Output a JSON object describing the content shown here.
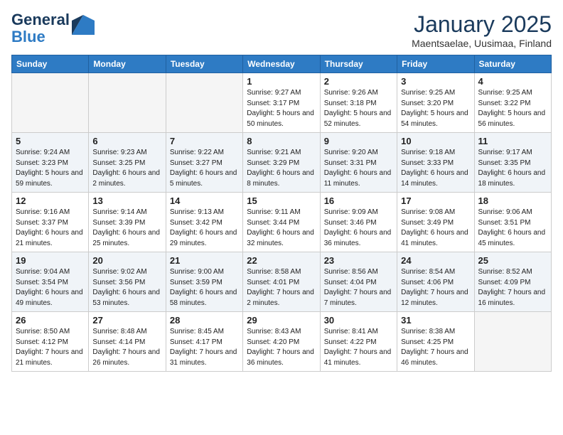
{
  "header": {
    "logo_general": "General",
    "logo_blue": "Blue",
    "month_year": "January 2025",
    "location": "Maentsaelae, Uusimaa, Finland"
  },
  "days_of_week": [
    "Sunday",
    "Monday",
    "Tuesday",
    "Wednesday",
    "Thursday",
    "Friday",
    "Saturday"
  ],
  "weeks": [
    [
      {
        "day": "",
        "sunrise": "",
        "sunset": "",
        "daylight": "",
        "empty": true
      },
      {
        "day": "",
        "sunrise": "",
        "sunset": "",
        "daylight": "",
        "empty": true
      },
      {
        "day": "",
        "sunrise": "",
        "sunset": "",
        "daylight": "",
        "empty": true
      },
      {
        "day": "1",
        "sunrise": "Sunrise: 9:27 AM",
        "sunset": "Sunset: 3:17 PM",
        "daylight": "Daylight: 5 hours and 50 minutes."
      },
      {
        "day": "2",
        "sunrise": "Sunrise: 9:26 AM",
        "sunset": "Sunset: 3:18 PM",
        "daylight": "Daylight: 5 hours and 52 minutes."
      },
      {
        "day": "3",
        "sunrise": "Sunrise: 9:25 AM",
        "sunset": "Sunset: 3:20 PM",
        "daylight": "Daylight: 5 hours and 54 minutes."
      },
      {
        "day": "4",
        "sunrise": "Sunrise: 9:25 AM",
        "sunset": "Sunset: 3:22 PM",
        "daylight": "Daylight: 5 hours and 56 minutes."
      }
    ],
    [
      {
        "day": "5",
        "sunrise": "Sunrise: 9:24 AM",
        "sunset": "Sunset: 3:23 PM",
        "daylight": "Daylight: 5 hours and 59 minutes."
      },
      {
        "day": "6",
        "sunrise": "Sunrise: 9:23 AM",
        "sunset": "Sunset: 3:25 PM",
        "daylight": "Daylight: 6 hours and 2 minutes."
      },
      {
        "day": "7",
        "sunrise": "Sunrise: 9:22 AM",
        "sunset": "Sunset: 3:27 PM",
        "daylight": "Daylight: 6 hours and 5 minutes."
      },
      {
        "day": "8",
        "sunrise": "Sunrise: 9:21 AM",
        "sunset": "Sunset: 3:29 PM",
        "daylight": "Daylight: 6 hours and 8 minutes."
      },
      {
        "day": "9",
        "sunrise": "Sunrise: 9:20 AM",
        "sunset": "Sunset: 3:31 PM",
        "daylight": "Daylight: 6 hours and 11 minutes."
      },
      {
        "day": "10",
        "sunrise": "Sunrise: 9:18 AM",
        "sunset": "Sunset: 3:33 PM",
        "daylight": "Daylight: 6 hours and 14 minutes."
      },
      {
        "day": "11",
        "sunrise": "Sunrise: 9:17 AM",
        "sunset": "Sunset: 3:35 PM",
        "daylight": "Daylight: 6 hours and 18 minutes."
      }
    ],
    [
      {
        "day": "12",
        "sunrise": "Sunrise: 9:16 AM",
        "sunset": "Sunset: 3:37 PM",
        "daylight": "Daylight: 6 hours and 21 minutes."
      },
      {
        "day": "13",
        "sunrise": "Sunrise: 9:14 AM",
        "sunset": "Sunset: 3:39 PM",
        "daylight": "Daylight: 6 hours and 25 minutes."
      },
      {
        "day": "14",
        "sunrise": "Sunrise: 9:13 AM",
        "sunset": "Sunset: 3:42 PM",
        "daylight": "Daylight: 6 hours and 29 minutes."
      },
      {
        "day": "15",
        "sunrise": "Sunrise: 9:11 AM",
        "sunset": "Sunset: 3:44 PM",
        "daylight": "Daylight: 6 hours and 32 minutes."
      },
      {
        "day": "16",
        "sunrise": "Sunrise: 9:09 AM",
        "sunset": "Sunset: 3:46 PM",
        "daylight": "Daylight: 6 hours and 36 minutes."
      },
      {
        "day": "17",
        "sunrise": "Sunrise: 9:08 AM",
        "sunset": "Sunset: 3:49 PM",
        "daylight": "Daylight: 6 hours and 41 minutes."
      },
      {
        "day": "18",
        "sunrise": "Sunrise: 9:06 AM",
        "sunset": "Sunset: 3:51 PM",
        "daylight": "Daylight: 6 hours and 45 minutes."
      }
    ],
    [
      {
        "day": "19",
        "sunrise": "Sunrise: 9:04 AM",
        "sunset": "Sunset: 3:54 PM",
        "daylight": "Daylight: 6 hours and 49 minutes."
      },
      {
        "day": "20",
        "sunrise": "Sunrise: 9:02 AM",
        "sunset": "Sunset: 3:56 PM",
        "daylight": "Daylight: 6 hours and 53 minutes."
      },
      {
        "day": "21",
        "sunrise": "Sunrise: 9:00 AM",
        "sunset": "Sunset: 3:59 PM",
        "daylight": "Daylight: 6 hours and 58 minutes."
      },
      {
        "day": "22",
        "sunrise": "Sunrise: 8:58 AM",
        "sunset": "Sunset: 4:01 PM",
        "daylight": "Daylight: 7 hours and 2 minutes."
      },
      {
        "day": "23",
        "sunrise": "Sunrise: 8:56 AM",
        "sunset": "Sunset: 4:04 PM",
        "daylight": "Daylight: 7 hours and 7 minutes."
      },
      {
        "day": "24",
        "sunrise": "Sunrise: 8:54 AM",
        "sunset": "Sunset: 4:06 PM",
        "daylight": "Daylight: 7 hours and 12 minutes."
      },
      {
        "day": "25",
        "sunrise": "Sunrise: 8:52 AM",
        "sunset": "Sunset: 4:09 PM",
        "daylight": "Daylight: 7 hours and 16 minutes."
      }
    ],
    [
      {
        "day": "26",
        "sunrise": "Sunrise: 8:50 AM",
        "sunset": "Sunset: 4:12 PM",
        "daylight": "Daylight: 7 hours and 21 minutes."
      },
      {
        "day": "27",
        "sunrise": "Sunrise: 8:48 AM",
        "sunset": "Sunset: 4:14 PM",
        "daylight": "Daylight: 7 hours and 26 minutes."
      },
      {
        "day": "28",
        "sunrise": "Sunrise: 8:45 AM",
        "sunset": "Sunset: 4:17 PM",
        "daylight": "Daylight: 7 hours and 31 minutes."
      },
      {
        "day": "29",
        "sunrise": "Sunrise: 8:43 AM",
        "sunset": "Sunset: 4:20 PM",
        "daylight": "Daylight: 7 hours and 36 minutes."
      },
      {
        "day": "30",
        "sunrise": "Sunrise: 8:41 AM",
        "sunset": "Sunset: 4:22 PM",
        "daylight": "Daylight: 7 hours and 41 minutes."
      },
      {
        "day": "31",
        "sunrise": "Sunrise: 8:38 AM",
        "sunset": "Sunset: 4:25 PM",
        "daylight": "Daylight: 7 hours and 46 minutes."
      },
      {
        "day": "",
        "sunrise": "",
        "sunset": "",
        "daylight": "",
        "empty": true
      }
    ]
  ]
}
